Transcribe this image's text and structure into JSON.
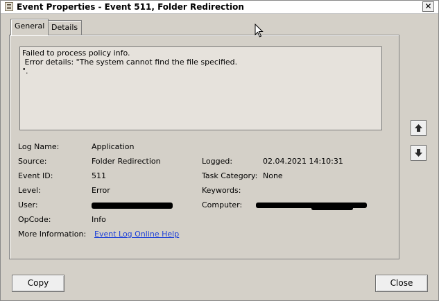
{
  "window": {
    "title": "Event Properties - Event 511, Folder Redirection",
    "close_glyph": "✕"
  },
  "tabs": [
    {
      "label": "General",
      "active": true
    },
    {
      "label": "Details",
      "active": false
    }
  ],
  "description": {
    "lines": [
      "Failed to process policy info.",
      " Error details: \"The system cannot find the file specified.",
      "\"."
    ]
  },
  "fields": {
    "log_name": {
      "label": "Log Name:",
      "value": "Application"
    },
    "source": {
      "label": "Source:",
      "value": "Folder Redirection"
    },
    "event_id": {
      "label": "Event ID:",
      "value": "511"
    },
    "level": {
      "label": "Level:",
      "value": "Error"
    },
    "user": {
      "label": "User:",
      "value": ""
    },
    "opcode": {
      "label": "OpCode:",
      "value": "Info"
    },
    "more_info": {
      "label": "More Information:",
      "link": "Event Log Online Help"
    },
    "logged": {
      "label": "Logged:",
      "value": "02.04.2021 14:10:31"
    },
    "task_category": {
      "label": "Task Category:",
      "value": "None"
    },
    "keywords": {
      "label": "Keywords:",
      "value": ""
    },
    "computer": {
      "label": "Computer:",
      "value": ""
    }
  },
  "side_buttons": {
    "up_icon": "arrow-up-icon",
    "down_icon": "arrow-down-icon"
  },
  "buttons": {
    "copy": "Copy",
    "close": "Close"
  },
  "colors": {
    "dialog_bg": "#d4d0c8",
    "link": "#1a3ed8"
  }
}
